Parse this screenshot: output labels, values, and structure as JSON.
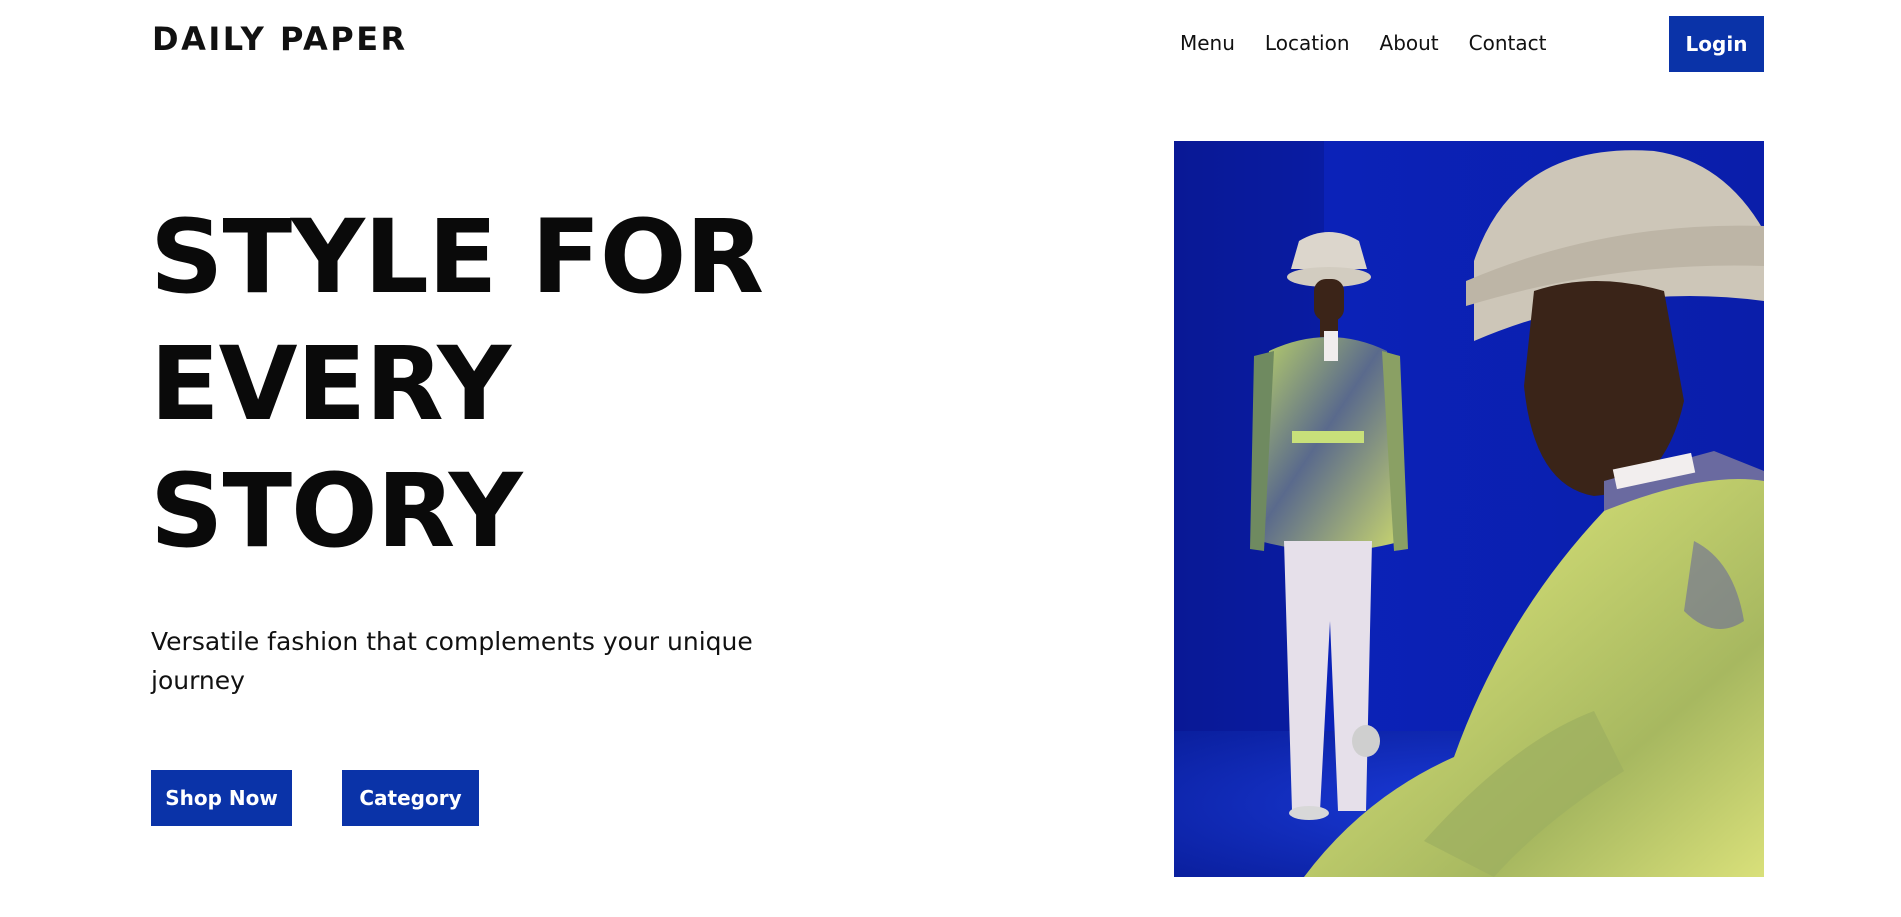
{
  "brand": {
    "logo_text": "DAILY PAPER"
  },
  "nav": {
    "items": [
      {
        "label": "Menu"
      },
      {
        "label": "Location"
      },
      {
        "label": "About"
      },
      {
        "label": "Contact"
      }
    ],
    "login_label": "Login"
  },
  "hero": {
    "title_lines": [
      "STYLE FOR",
      "EVERY",
      "STORY"
    ],
    "subtitle": "Versatile fashion that complements your unique journey",
    "primary_cta": "Shop Now",
    "secondary_cta": "Category",
    "image_icon": "fashion-photo"
  },
  "colors": {
    "accent": "#0a33a8",
    "text": "#0a0a0a",
    "background": "#ffffff",
    "photo_backdrop": "#0a1fb0"
  }
}
